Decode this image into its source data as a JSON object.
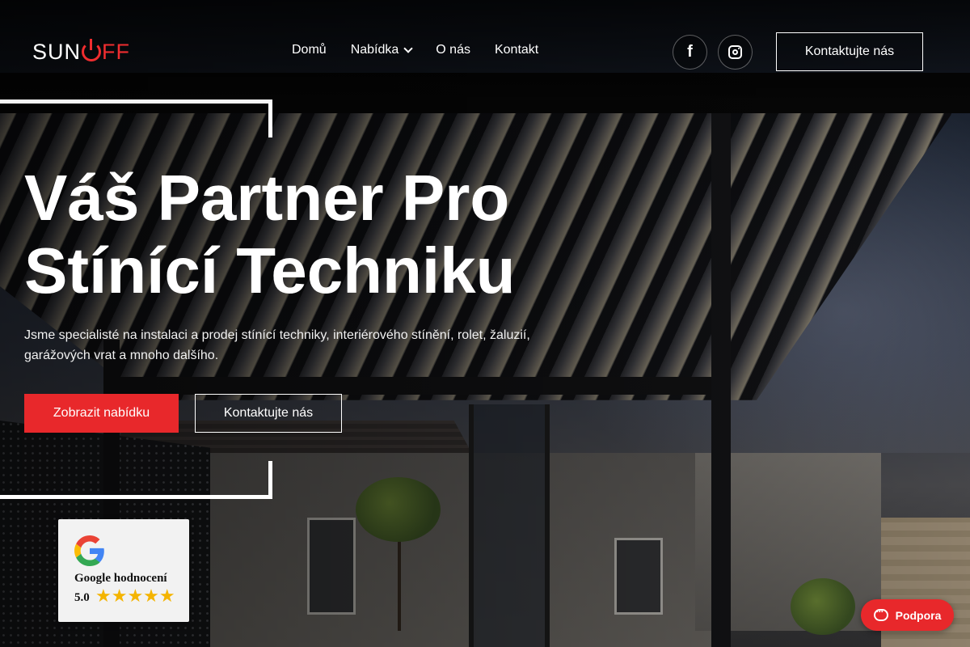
{
  "header": {
    "logo_text_left": "SUN",
    "logo_text_right": "FF",
    "nav": [
      "Domů",
      "Nabídka",
      "O nás",
      "Kontakt"
    ],
    "social": [
      "facebook-icon",
      "instagram-icon"
    ],
    "cta_label": "Kontaktujte nás"
  },
  "hero": {
    "title_line1": "Váš Partner Pro",
    "title_line2": "Stínící Techniku",
    "subtitle": "Jsme specialisté na instalaci a prodej stínící techniky, interiérového stínění, rolet, žaluzií, garážových vrat a mnoho dalšího.",
    "primary_button": "Zobrazit nabídku",
    "secondary_button": "Kontaktujte nás"
  },
  "google_badge": {
    "title": "Google hodnocení",
    "score": "5.0",
    "stars": "★★★★★",
    "rating_value": 5
  },
  "support": {
    "label": "Podpora"
  },
  "colors": {
    "accent": "#e8282b",
    "star": "#f4b400"
  }
}
